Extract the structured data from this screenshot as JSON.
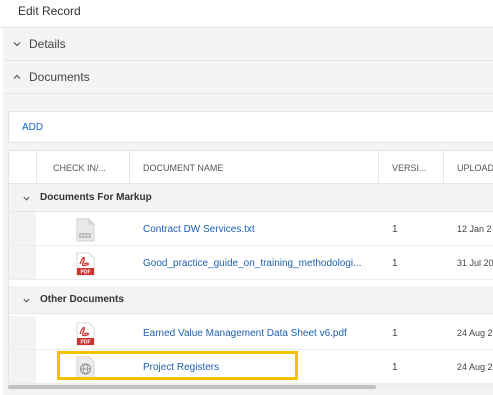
{
  "window": {
    "title": "Edit Record"
  },
  "sections": {
    "details": {
      "label": "Details",
      "expanded": false
    },
    "documents": {
      "label": "Documents",
      "expanded": true
    }
  },
  "toolbar": {
    "add_label": "ADD"
  },
  "grid": {
    "columns": [
      "CHECK IN/...",
      "DOCUMENT NAME",
      "VERSI...",
      "UPLOAD"
    ],
    "groups": [
      {
        "label": "Documents For Markup",
        "rows": [
          {
            "icon": "txt-file-icon",
            "name": "Contract DW Services.txt",
            "version": "1",
            "uploaded": "12 Jan 2"
          },
          {
            "icon": "pdf-file-icon",
            "name": "Good_practice_guide_on_training_methodologi...",
            "version": "1",
            "uploaded": "31 Jul 20"
          }
        ]
      },
      {
        "label": "Other Documents",
        "rows": [
          {
            "icon": "pdf-file-icon",
            "name": "Earned Value Management Data Sheet v6.pdf",
            "version": "1",
            "uploaded": "24 Aug 2"
          },
          {
            "icon": "globe-link-icon",
            "name": "Project Registers",
            "version": "1",
            "uploaded": "24 Aug 2"
          }
        ]
      }
    ]
  },
  "colors": {
    "link": "#1f5fb0",
    "highlight": "#f2c200",
    "pdf": "#d0312d"
  }
}
